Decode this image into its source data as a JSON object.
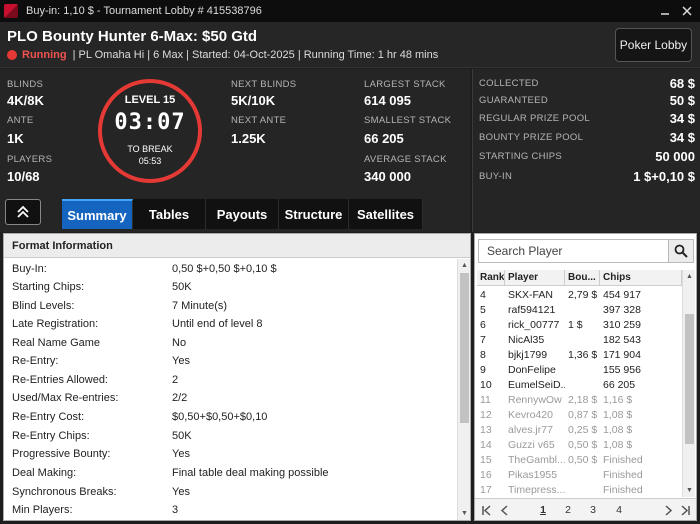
{
  "window": {
    "title": "Buy-in: 1,10 $ - Tournament Lobby # 415538796",
    "minimize_icon": "minimize-icon",
    "close_icon": "close-icon"
  },
  "header": {
    "tournament_name": "PLO Bounty Hunter 6-Max: $50 Gtd",
    "status": "Running",
    "info": "| PL Omaha Hi | 6 Max | Started: 04-Oct-2025 | Running Time: 1 hr  48 mins",
    "poker_lobby_label": "Poker Lobby",
    "status_color": "#e53935"
  },
  "stats": {
    "blinds_label": "BLINDS",
    "blinds": "4K/8K",
    "ante_label": "ANTE",
    "ante": "1K",
    "players_label": "PLAYERS",
    "players": "10/68",
    "level": "LEVEL 15",
    "clock": "03:07",
    "to_break_label": "TO BREAK",
    "to_break": "05:53",
    "next_blinds_label": "NEXT BLINDS",
    "next_blinds": "5K/10K",
    "next_ante_label": "NEXT ANTE",
    "next_ante": "1.25K",
    "largest_stack_label": "LARGEST STACK",
    "largest_stack": "614 095",
    "smallest_stack_label": "SMALLEST STACK",
    "smallest_stack": "66 205",
    "average_stack_label": "AVERAGE STACK",
    "average_stack": "340 000"
  },
  "prize": [
    {
      "label": "COLLECTED",
      "value": "68 $"
    },
    {
      "label": "GUARANTEED",
      "value": "50 $"
    },
    {
      "label": "REGULAR PRIZE POOL",
      "value": "34 $"
    },
    {
      "label": "BOUNTY PRIZE POOL",
      "value": "34 $"
    },
    {
      "label": "STARTING CHIPS",
      "value": "50 000"
    },
    {
      "label": "BUY-IN",
      "value": "1 $+0,10 $"
    }
  ],
  "tabs": {
    "collapse_icon": "double-chevron-up-icon",
    "items": [
      {
        "label": "Summary",
        "active": true
      },
      {
        "label": "Tables",
        "active": false
      },
      {
        "label": "Payouts",
        "active": false
      },
      {
        "label": "Structure",
        "active": false
      },
      {
        "label": "Satellites",
        "active": false
      }
    ]
  },
  "format": {
    "title": "Format Information",
    "rows": [
      {
        "key": "Buy-In:",
        "value": "0,50 $+0,50 $+0,10 $"
      },
      {
        "key": "Starting Chips:",
        "value": "50K"
      },
      {
        "key": "Blind Levels:",
        "value": "7 Minute(s)"
      },
      {
        "key": "Late Registration:",
        "value": "Until end of level 8"
      },
      {
        "key": "Real Name Game",
        "value": "No"
      },
      {
        "key": "Re-Entry:",
        "value": "Yes"
      },
      {
        "key": "Re-Entries Allowed:",
        "value": "2"
      },
      {
        "key": "Used/Max Re-entries:",
        "value": "2/2"
      },
      {
        "key": "Re-Entry Cost:",
        "value": "$0,50+$0,50+$0,10"
      },
      {
        "key": "Re-Entry Chips:",
        "value": "50K"
      },
      {
        "key": "Progressive Bounty:",
        "value": "Yes"
      },
      {
        "key": "Deal Making:",
        "value": "Final table deal making possible"
      },
      {
        "key": "Synchronous Breaks:",
        "value": "Yes"
      },
      {
        "key": "Min Players:",
        "value": "3"
      }
    ]
  },
  "players": {
    "search_placeholder": "Search Player",
    "search_icon": "search-icon",
    "columns": [
      "Rank",
      "Player",
      "Bou...",
      "Chips"
    ],
    "rows": [
      {
        "rank": "4",
        "player": "SKX-FAN",
        "bounty": "2,79 $",
        "chips": "454 917",
        "out": false
      },
      {
        "rank": "5",
        "player": "raf594121",
        "bounty": "",
        "chips": "397 328",
        "out": false
      },
      {
        "rank": "6",
        "player": "rick_00777",
        "bounty": "1 $",
        "chips": "310 259",
        "out": false
      },
      {
        "rank": "7",
        "player": "NicAl35",
        "bounty": "",
        "chips": "182 543",
        "out": false
      },
      {
        "rank": "8",
        "player": "bjkj1799",
        "bounty": "1,36 $",
        "chips": "171 904",
        "out": false
      },
      {
        "rank": "9",
        "player": "DonFelipe",
        "bounty": "",
        "chips": "155 956",
        "out": false
      },
      {
        "rank": "10",
        "player": "EumelSeiD..",
        "bounty": "",
        "chips": "66 205",
        "out": false
      },
      {
        "rank": "11",
        "player": "RennywOw",
        "bounty": "2,18 $",
        "chips": "1,16 $",
        "out": true
      },
      {
        "rank": "12",
        "player": "Kevro420",
        "bounty": "0,87 $",
        "chips": "1,08 $",
        "out": true
      },
      {
        "rank": "13",
        "player": "alves.jr77",
        "bounty": "0,25 $",
        "chips": "1,08 $",
        "out": true
      },
      {
        "rank": "14",
        "player": "Guzzi v65",
        "bounty": "0,50 $",
        "chips": "1,08 $",
        "out": true
      },
      {
        "rank": "15",
        "player": "TheGambl...",
        "bounty": "0,50 $",
        "chips": "Finished",
        "out": true
      },
      {
        "rank": "16",
        "player": "Pikas1955",
        "bounty": "",
        "chips": "Finished",
        "out": true
      },
      {
        "rank": "17",
        "player": "Timepress...",
        "bounty": "",
        "chips": "Finished",
        "out": true
      }
    ],
    "pager": {
      "first_icon": "first-page-icon",
      "prev_icon": "prev-page-icon",
      "pages": [
        "1",
        "2",
        "3",
        "4"
      ],
      "current": "1",
      "next_icon": "next-page-icon",
      "last_icon": "last-page-icon"
    }
  }
}
